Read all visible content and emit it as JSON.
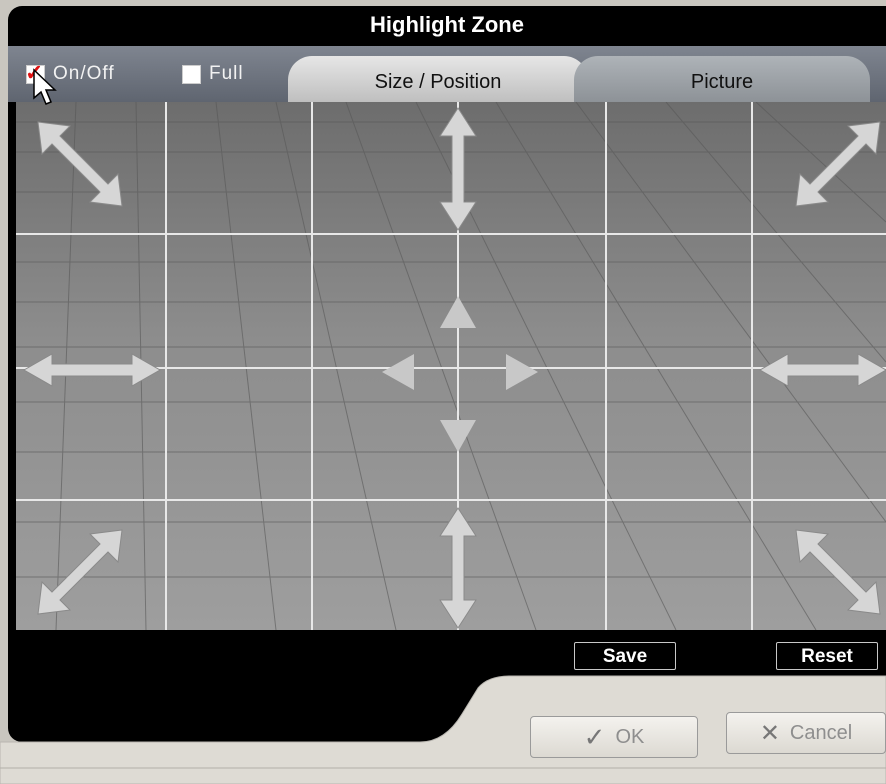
{
  "window": {
    "title": "Highlight Zone"
  },
  "toggles": {
    "onoff": {
      "label": "On/Off",
      "checked": true
    },
    "full": {
      "label": "Full",
      "checked": false
    }
  },
  "tabs": [
    {
      "label": "Size / Position",
      "active": true
    },
    {
      "label": "Picture",
      "active": false
    }
  ],
  "actions": {
    "save": "Save",
    "reset": "Reset"
  },
  "dialog": {
    "ok": "OK",
    "cancel": "Cancel"
  },
  "icons": {
    "resize": [
      "resize-nw-se-icon",
      "resize-vertical-icon",
      "resize-ne-sw-icon",
      "resize-horizontal-icon"
    ],
    "move": [
      "move-up-icon",
      "move-down-icon",
      "move-left-icon",
      "move-right-icon"
    ],
    "check": "checkmark-icon",
    "cancel": "x-icon"
  },
  "colors": {
    "check_accent": "#e01010",
    "panel": "#000000"
  }
}
